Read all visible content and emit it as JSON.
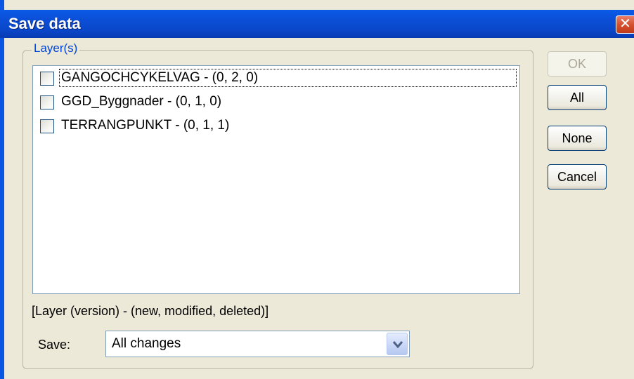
{
  "window": {
    "title": "Save data",
    "close_symbol": "✕"
  },
  "layers_group": {
    "legend": "Layer(s)",
    "items": [
      {
        "label": "GANGOCHCYKELVAG - (0, 2, 0)",
        "checked": false,
        "focused": true
      },
      {
        "label": "GGD_Byggnader - (0, 1, 0)",
        "checked": false,
        "focused": false
      },
      {
        "label": "TERRANGPUNKT - (0, 1, 1)",
        "checked": false,
        "focused": false
      }
    ],
    "caption": "[Layer (version) - (new, modified, deleted)]",
    "save_label": "Save:",
    "save_select_value": "All changes"
  },
  "buttons": {
    "ok": "OK",
    "all": "All",
    "none": "None",
    "cancel": "Cancel"
  },
  "colors": {
    "title_bar": "#0a4fd6",
    "legend_text": "#0046d5",
    "close_button": "#d4512f"
  },
  "icons": {
    "close": "close-icon",
    "dropdown": "chevron-down-icon"
  }
}
